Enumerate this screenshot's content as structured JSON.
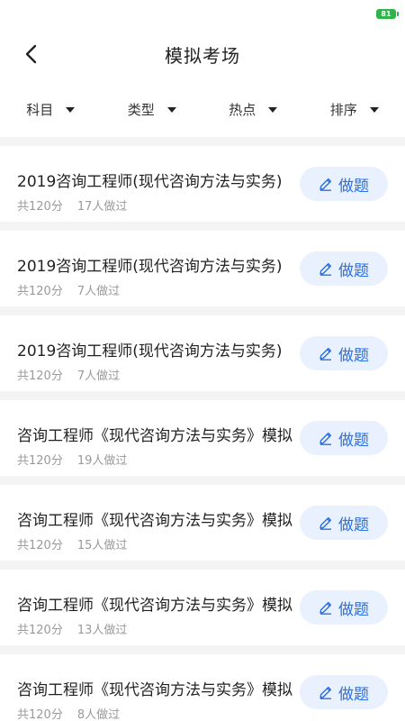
{
  "status": {
    "battery": "81"
  },
  "header": {
    "title": "模拟考场",
    "back_icon": "chevron-left-icon"
  },
  "filters": [
    {
      "label": "科目"
    },
    {
      "label": "类型"
    },
    {
      "label": "热点"
    },
    {
      "label": "排序"
    }
  ],
  "items": [
    {
      "title": "2019咨询工程师(现代咨询方法与实务)",
      "score": "共120分",
      "count": "17人做过",
      "button": "做题"
    },
    {
      "title": "2019咨询工程师(现代咨询方法与实务)",
      "score": "共120分",
      "count": "7人做过",
      "button": "做题"
    },
    {
      "title": "2019咨询工程师(现代咨询方法与实务)",
      "score": "共120分",
      "count": "7人做过",
      "button": "做题"
    },
    {
      "title": "咨询工程师《现代咨询方法与实务》模拟",
      "score": "共120分",
      "count": "19人做过",
      "button": "做题"
    },
    {
      "title": "咨询工程师《现代咨询方法与实务》模拟",
      "score": "共120分",
      "count": "15人做过",
      "button": "做题"
    },
    {
      "title": "咨询工程师《现代咨询方法与实务》模拟",
      "score": "共120分",
      "count": "13人做过",
      "button": "做题"
    },
    {
      "title": "咨询工程师《现代咨询方法与实务》模拟",
      "score": "共120分",
      "count": "8人做过",
      "button": "做题"
    }
  ],
  "colors": {
    "accent": "#2b6fe0",
    "button_bg": "#e8f1fd",
    "meta": "#9a9a9a",
    "battery": "#2fb44a"
  }
}
